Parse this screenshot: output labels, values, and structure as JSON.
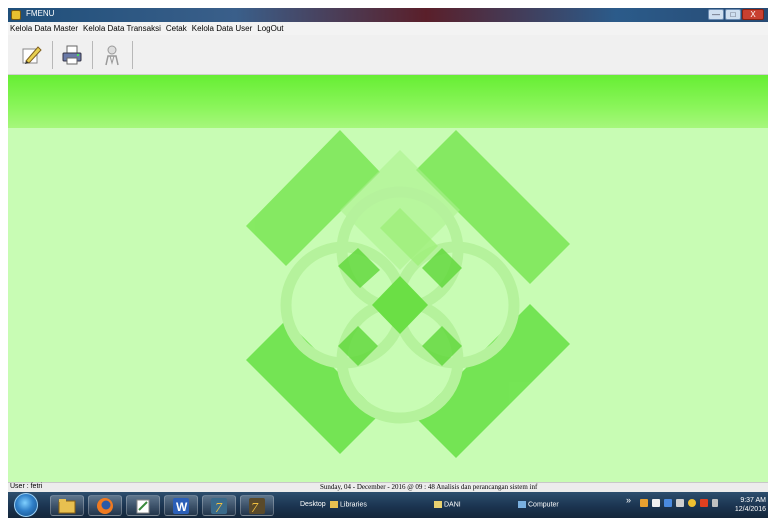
{
  "window": {
    "title": "FMENU"
  },
  "window_controls": {
    "minimize": "—",
    "maximize": "□",
    "close": "X"
  },
  "menu": {
    "items": [
      "Kelola Data Master",
      "Kelola Data Transaksi",
      "Cetak",
      "Kelola Data User",
      "LogOut"
    ]
  },
  "toolbar": {
    "icons": [
      "edit-icon",
      "printer-icon",
      "user-key-icon"
    ]
  },
  "status": {
    "user": "User : fetri",
    "info": "Sunday, 04 - December - 2016 @ 09 : 48   Analisis dan perancangan sistem inf"
  },
  "taskbar": {
    "apps": [
      "start-orb-icon",
      "file-explorer-icon",
      "firefox-icon",
      "notepad-icon",
      "word-icon",
      "app-7-icon",
      "app-7b-icon"
    ],
    "desktop_label": "Desktop",
    "libraries_label": "Libraries",
    "dani_label": "DANI",
    "computer_label": "Computer",
    "overflow": "»",
    "time": "9:37 AM",
    "date": "12/4/2016"
  },
  "colors": {
    "accent_green": "#66ee33",
    "client_green": "#c8fcb4",
    "logo_green": "#66e04a"
  }
}
